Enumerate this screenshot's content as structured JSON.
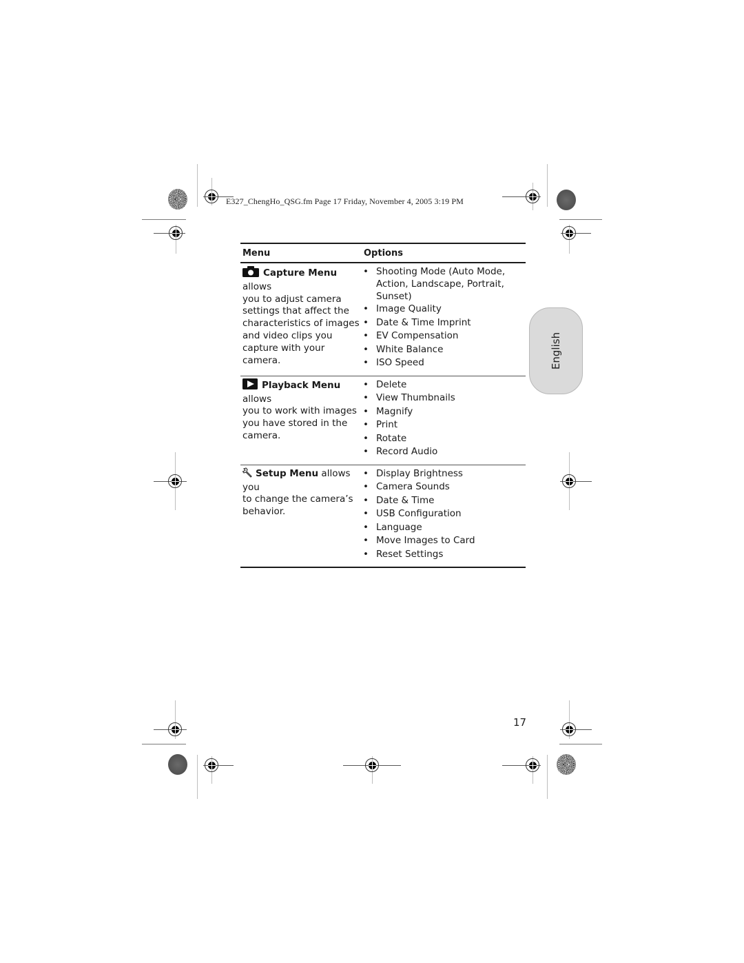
{
  "header": {
    "file_info": "E327_ChengHo_QSG.fm  Page 17  Friday, November 4, 2005  3:19 PM"
  },
  "table": {
    "columns": [
      "Menu",
      "Options"
    ],
    "rows": [
      {
        "icon": "camera-icon",
        "menu_name": "Capture Menu",
        "description_lines": [
          " allows",
          "you to adjust camera",
          "settings that affect the",
          "characteristics of images",
          "and video clips you",
          "capture with your camera."
        ],
        "options": [
          "Shooting Mode (Auto Mode, Action, Landscape, Portrait, Sunset)",
          "Image Quality",
          "Date & Time Imprint",
          "EV Compensation",
          "White Balance",
          "ISO Speed"
        ]
      },
      {
        "icon": "playback-icon",
        "menu_name": "Playback Menu",
        "description_lines": [
          " allows",
          "you to work with images",
          "you have stored in the",
          "camera."
        ],
        "options": [
          "Delete",
          "View Thumbnails",
          "Magnify",
          "Print",
          "Rotate",
          "Record Audio"
        ]
      },
      {
        "icon": "wrench-icon",
        "menu_name": "Setup Menu",
        "description_lines": [
          " allows you",
          "to change the camera’s",
          "behavior."
        ],
        "options": [
          "Display Brightness",
          "Camera Sounds",
          "Date & Time",
          "USB Configuration",
          "Language",
          "Move Images to Card",
          "Reset Settings"
        ]
      }
    ],
    "bullet": "•"
  },
  "side_tab": {
    "label": "English"
  },
  "footer": {
    "page_number": "17"
  },
  "colors": {
    "tab_fill": "#dadada",
    "rule": "#1a1a1a"
  }
}
